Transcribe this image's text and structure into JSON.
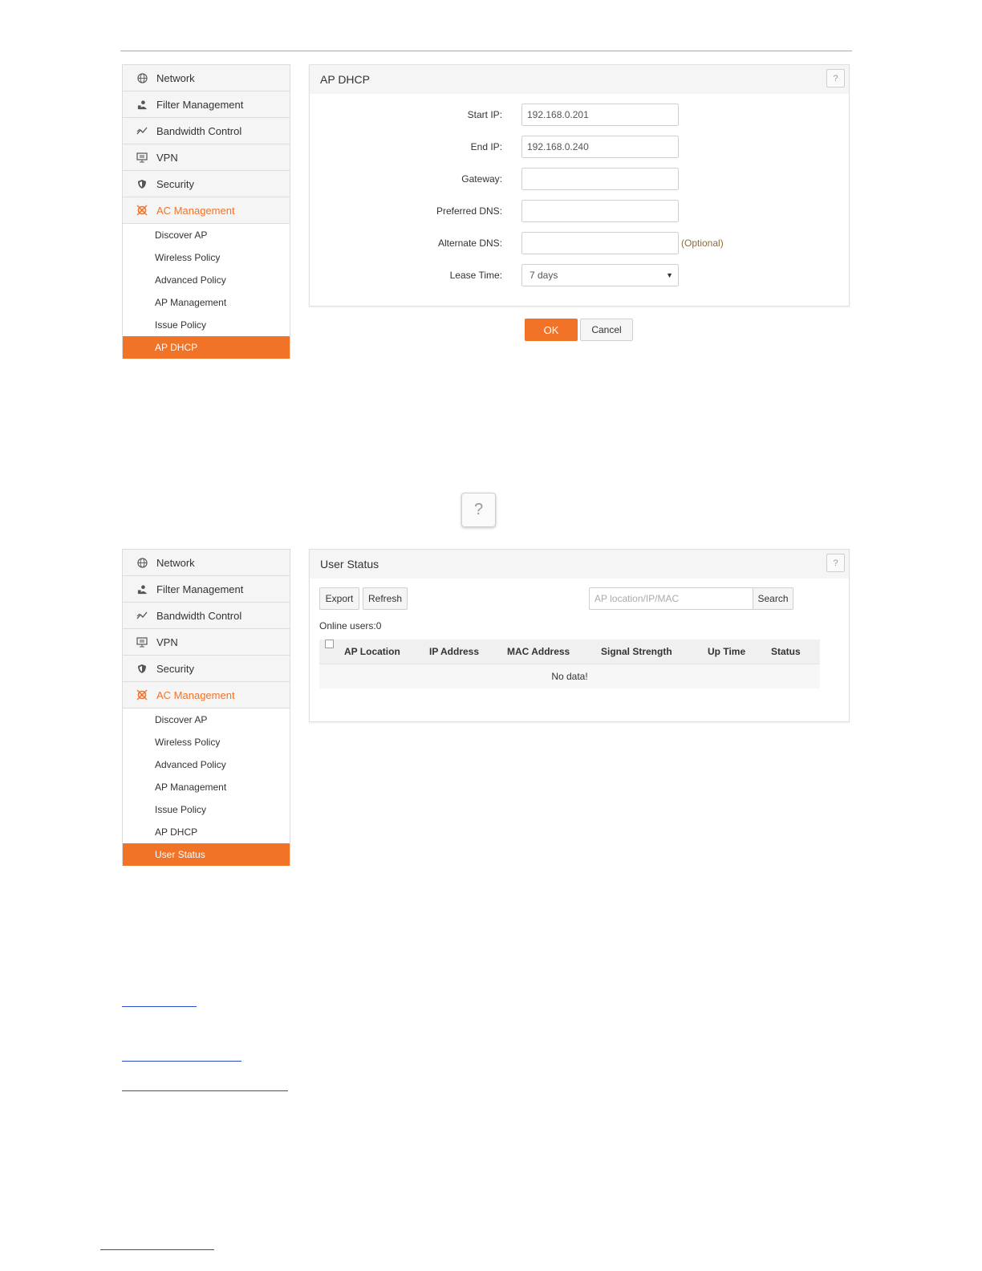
{
  "sidebar_top": {
    "main_items": [
      {
        "label": "Network",
        "icon": "globe-icon"
      },
      {
        "label": "Filter Management",
        "icon": "filter-users-icon"
      },
      {
        "label": "Bandwidth Control",
        "icon": "chart-line-icon"
      },
      {
        "label": "VPN",
        "icon": "monitor-icon"
      },
      {
        "label": "Security",
        "icon": "shield-icon"
      },
      {
        "label": "AC Management",
        "icon": "ac-gear-icon"
      }
    ],
    "sub_items": [
      "Discover AP",
      "Wireless Policy",
      "Advanced Policy",
      "AP Management",
      "Issue Policy",
      "AP DHCP"
    ],
    "active_sub": "AP DHCP"
  },
  "ap_dhcp": {
    "title": "AP DHCP",
    "help": "?",
    "fields": {
      "start_ip": {
        "label": "Start IP:",
        "value": "192.168.0.201"
      },
      "end_ip": {
        "label": "End IP:",
        "value": "192.168.0.240"
      },
      "gateway": {
        "label": "Gateway:",
        "value": ""
      },
      "preferred_dns": {
        "label": "Preferred DNS:",
        "value": ""
      },
      "alternate_dns": {
        "label": "Alternate DNS:",
        "value": "",
        "hint": "(Optional)"
      },
      "lease_time": {
        "label": "Lease Time:",
        "value": "7 days"
      }
    },
    "ok_label": "OK",
    "cancel_label": "Cancel"
  },
  "standalone_help": "?",
  "sidebar_bottom": {
    "main_items": [
      {
        "label": "Network",
        "icon": "globe-icon"
      },
      {
        "label": "Filter Management",
        "icon": "filter-users-icon"
      },
      {
        "label": "Bandwidth Control",
        "icon": "chart-line-icon"
      },
      {
        "label": "VPN",
        "icon": "monitor-icon"
      },
      {
        "label": "Security",
        "icon": "shield-icon"
      },
      {
        "label": "AC Management",
        "icon": "ac-gear-icon"
      }
    ],
    "sub_items": [
      "Discover AP",
      "Wireless Policy",
      "Advanced Policy",
      "AP Management",
      "Issue Policy",
      "AP DHCP",
      "User Status"
    ],
    "active_sub": "User Status"
  },
  "user_status": {
    "title": "User Status",
    "help": "?",
    "export_label": "Export",
    "refresh_label": "Refresh",
    "search_placeholder": "AP location/IP/MAC",
    "search_label": "Search",
    "online_users": "Online users:0",
    "columns": [
      "AP Location",
      "IP Address",
      "MAC Address",
      "Signal Strength",
      "Up Time",
      "Status"
    ],
    "empty_text": "No data!"
  },
  "colors": {
    "accent": "#f07328",
    "link": "#2a4fc4"
  }
}
